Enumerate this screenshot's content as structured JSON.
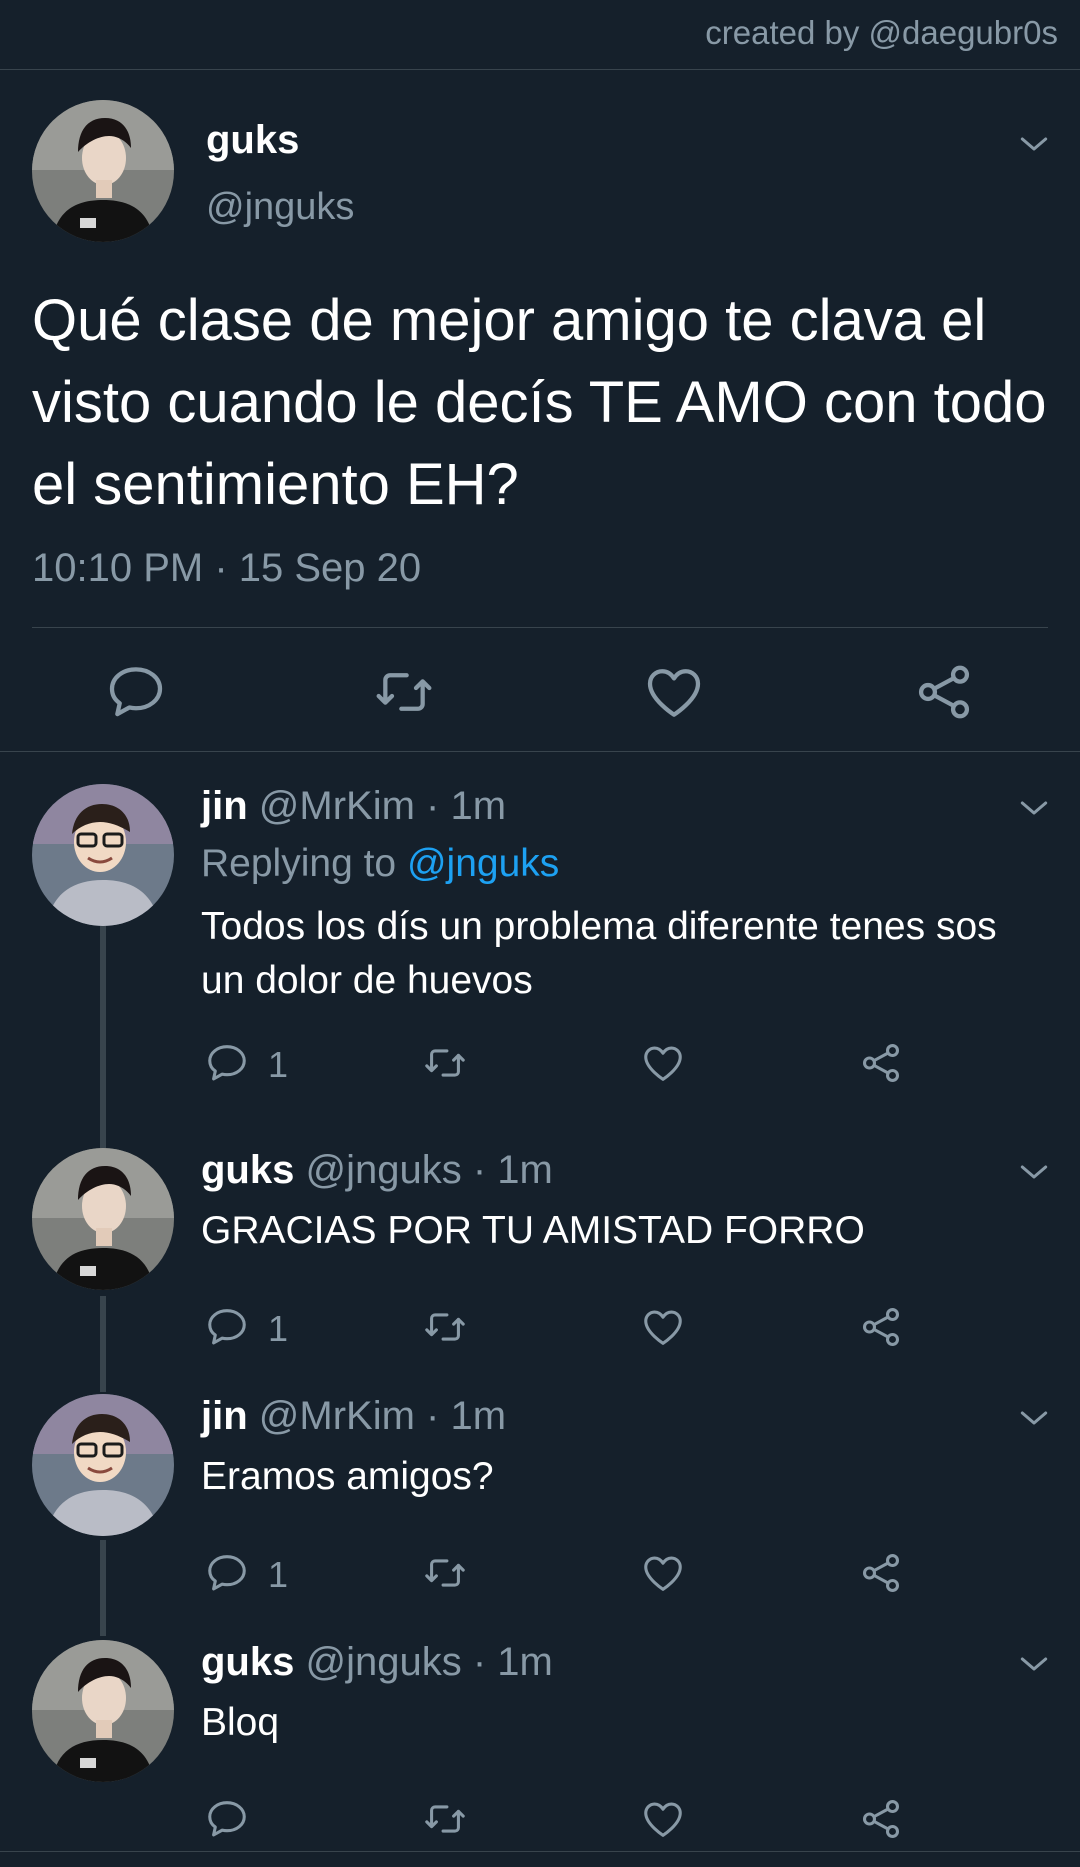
{
  "credit": "created by @daegubr0s",
  "colors": {
    "background": "#15202b",
    "muted": "#8899a6",
    "accent": "#1da1f2",
    "divider": "#38444d"
  },
  "main_tweet": {
    "name": "guks",
    "handle": "@jnguks",
    "text": "Qué clase de mejor amigo te clava el visto cuando le decís TE AMO con todo el sentimiento EH?",
    "timestamp": "10:10 PM · 15 Sep 20",
    "actions": [
      "reply-icon",
      "retweet-icon",
      "like-icon",
      "share-icon"
    ]
  },
  "replies": [
    {
      "name": "jin",
      "meta": "@MrKim · 1m",
      "replying_prefix": "Replying to",
      "replying_to": "@jnguks",
      "text": "Todos los dís un problema diferente tenes sos un dolor de huevos",
      "reply_count": "1"
    },
    {
      "name": "guks",
      "meta": "@jnguks · 1m",
      "text": "GRACIAS POR TU AMISTAD FORRO",
      "reply_count": "1"
    },
    {
      "name": "jin",
      "meta": "@MrKim · 1m",
      "text": "Eramos amigos?",
      "reply_count": "1"
    },
    {
      "name": "guks",
      "meta": "@jnguks · 1m",
      "text": "Bloq",
      "reply_count": ""
    }
  ]
}
